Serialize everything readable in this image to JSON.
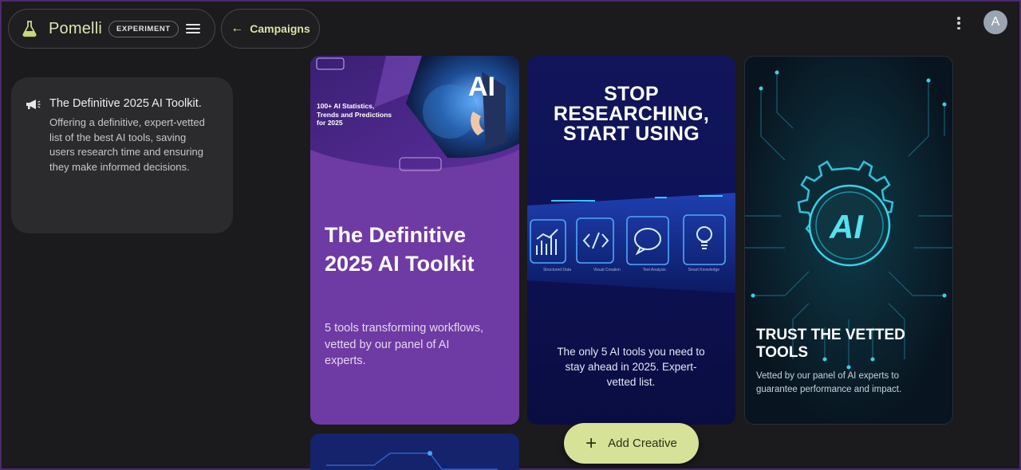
{
  "header": {
    "brand": "Pomelli",
    "badge": "EXPERIMENT",
    "back_label": "Campaigns",
    "avatar_letter": "A"
  },
  "summary": {
    "title": "The Definitive 2025 AI Toolkit.",
    "body": "Offering a definitive, expert-vetted list of the best AI tools, saving users research time and ensuring they make informed decisions."
  },
  "cards": {
    "purple": {
      "stat_text": "100+ AI Statistics, Trends and Predictions for 2025",
      "ai_word": "AI",
      "title": "The Definitive 2025 AI Toolkit",
      "description": "5 tools transforming workflows, vetted by our panel of AI experts."
    },
    "blue": {
      "headline_1": "STOP",
      "headline_2": "RESEARCHING,",
      "headline_3": "START USING",
      "icon_labels": [
        "Structured Data",
        "Visual Creation",
        "Text Analysis",
        "Smart Knowledge"
      ],
      "caption": "The only 5 AI tools you need to stay ahead in 2025. Expert-vetted list."
    },
    "teal": {
      "ai_word": "AI",
      "title": "TRUST THE VETTED TOOLS",
      "description": "Vetted by our panel of AI experts to guarantee performance and impact."
    }
  },
  "fab": {
    "label": "Add Creative"
  },
  "colors": {
    "accent": "#d6e298",
    "brand_text": "#d9e6b3",
    "purple_card": "#6e3aa3",
    "blue_card": "#12155a",
    "teal_card": "#0c1a24"
  }
}
